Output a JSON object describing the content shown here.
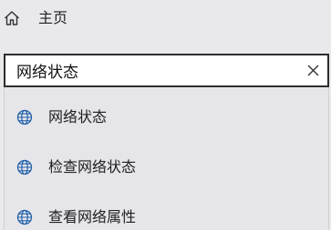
{
  "home": {
    "label": "主页",
    "icon": "home-icon"
  },
  "search": {
    "value": "网络状态",
    "clear_icon": "close-icon"
  },
  "results": [
    {
      "label": "网络状态",
      "icon": "globe-icon"
    },
    {
      "label": "检查网络状态",
      "icon": "globe-icon"
    },
    {
      "label": "查看网络属性",
      "icon": "globe-icon"
    }
  ]
}
